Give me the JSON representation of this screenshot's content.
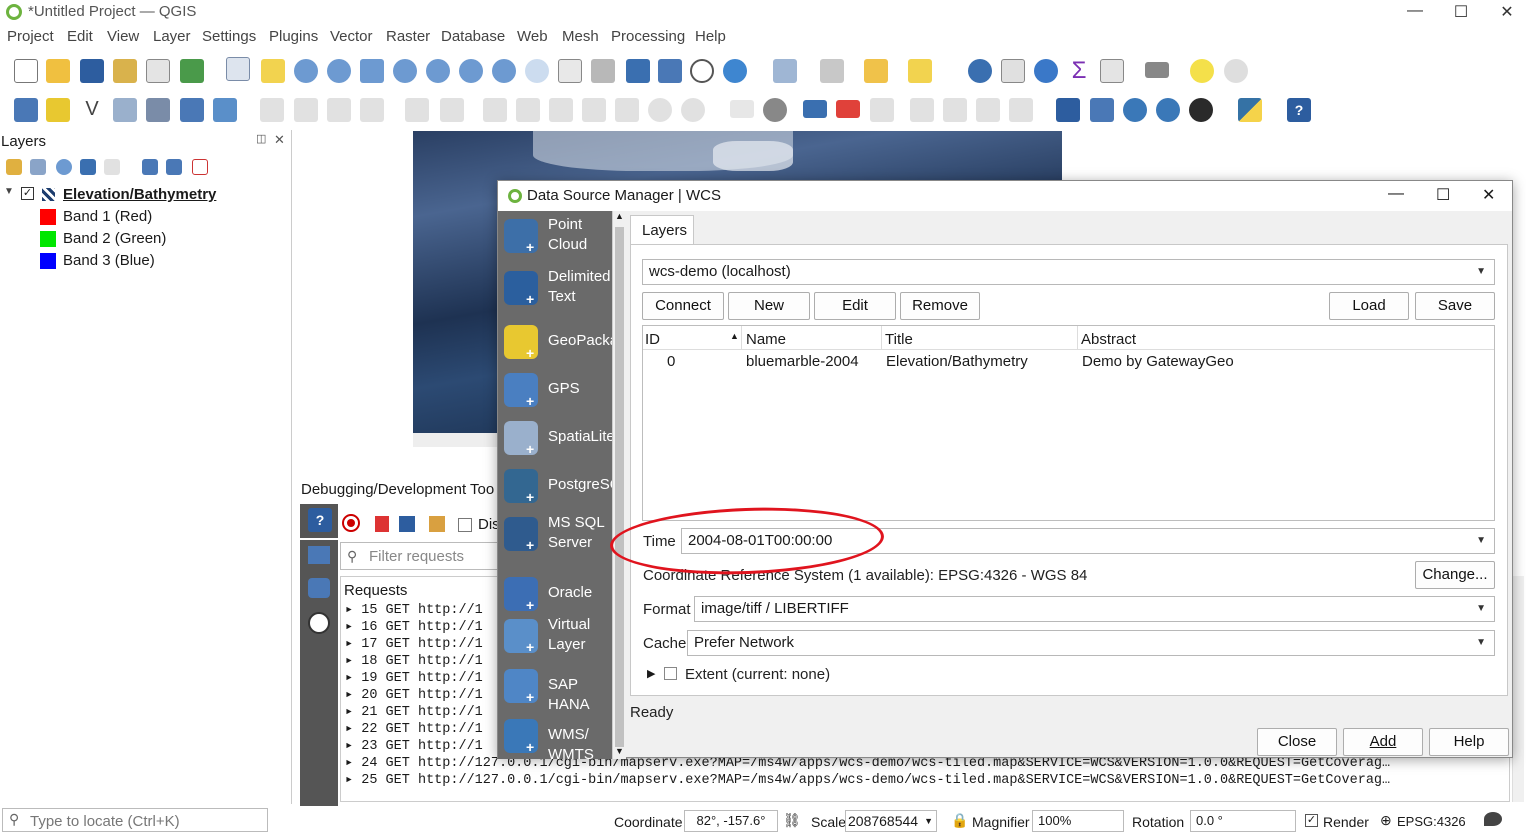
{
  "window": {
    "title": "*Untitled Project — QGIS"
  },
  "menu": [
    "Project",
    "Edit",
    "View",
    "Layer",
    "Settings",
    "Plugins",
    "Vector",
    "Raster",
    "Database",
    "Web",
    "Mesh",
    "Processing",
    "Help"
  ],
  "layers_panel": {
    "title": "Layers",
    "group": "Elevation/Bathymetry",
    "bands": [
      {
        "label": "Band 1 (Red)",
        "color": "#ff0000"
      },
      {
        "label": "Band 2 (Green)",
        "color": "#00e600"
      },
      {
        "label": "Band 3 (Blue)",
        "color": "#0000ff"
      }
    ]
  },
  "debug": {
    "title": "Debugging/Development Too",
    "checkbox_label": "Dis",
    "filter_placeholder": "Filter requests",
    "requests_header": "Requests",
    "requests": [
      {
        "n": "15",
        "m": "GET",
        "u": "http://1"
      },
      {
        "n": "16",
        "m": "GET",
        "u": "http://1"
      },
      {
        "n": "17",
        "m": "GET",
        "u": "http://1"
      },
      {
        "n": "18",
        "m": "GET",
        "u": "http://1"
      },
      {
        "n": "19",
        "m": "GET",
        "u": "http://1"
      },
      {
        "n": "20",
        "m": "GET",
        "u": "http://1"
      },
      {
        "n": "21",
        "m": "GET",
        "u": "http://1"
      },
      {
        "n": "22",
        "m": "GET",
        "u": "http://1"
      },
      {
        "n": "23",
        "m": "GET",
        "u": "http://1"
      },
      {
        "n": "24",
        "m": "GET",
        "u": "http://127.0.0.1/cgi-bin/mapserv.exe?MAP=/ms4w/apps/wcs-demo/wcs-tiled.map&SERVICE=WCS&VERSION=1.0.0&REQUEST=GetCoverag…"
      },
      {
        "n": "25",
        "m": "GET",
        "u": "http://127.0.0.1/cgi-bin/mapserv.exe?MAP=/ms4w/apps/wcs-demo/wcs-tiled.map&SERVICE=WCS&VERSION=1.0.0&REQUEST=GetCoverag…"
      }
    ]
  },
  "dialog": {
    "title": "Data Source Manager | WCS",
    "sidebar": [
      {
        "label": "Point Cloud",
        "icon": "point-cloud-icon",
        "color": "#3d6fa8"
      },
      {
        "label": "Delimited Text",
        "icon": "delimited-text-icon",
        "color": "#2b5f9e"
      },
      {
        "label": "GeoPackage",
        "icon": "geopackage-icon",
        "color": "#e8c830"
      },
      {
        "label": "GPS",
        "icon": "gps-icon",
        "color": "#4a7fc1"
      },
      {
        "label": "SpatiaLite",
        "icon": "spatialite-icon",
        "color": "#9ab0cc"
      },
      {
        "label": "PostgreSQL",
        "icon": "postgresql-icon",
        "color": "#336791"
      },
      {
        "label": "MS SQL Server",
        "icon": "mssql-icon",
        "color": "#2f5b8e"
      },
      {
        "label": "Oracle",
        "icon": "oracle-icon",
        "color": "#3c6eb4"
      },
      {
        "label": "Virtual Layer",
        "icon": "virtual-layer-icon",
        "color": "#5a8fc9"
      },
      {
        "label": "SAP HANA",
        "icon": "sap-hana-icon",
        "color": "#4f86c6"
      },
      {
        "label": "WMS/ WMTS",
        "icon": "wms-icon",
        "color": "#3a78b8"
      }
    ],
    "tab": "Layers",
    "connection": "wcs-demo (localhost)",
    "buttons": {
      "connect": "Connect",
      "new": "New",
      "edit": "Edit",
      "remove": "Remove",
      "load": "Load",
      "save": "Save"
    },
    "table": {
      "headers": [
        "ID",
        "Name",
        "Title",
        "Abstract"
      ],
      "rows": [
        {
          "id": "0",
          "name": "bluemarble-2004",
          "title": "Elevation/Bathymetry",
          "abstract": "Demo by GatewayGeo"
        }
      ]
    },
    "time_label": "Time",
    "time_value": "2004-08-01T00:00:00",
    "crs_text": "Coordinate Reference System (1 available): EPSG:4326 - WGS 84",
    "change_button": "Change...",
    "format_label": "Format",
    "format_value": "image/tiff / LIBERTIFF",
    "cache_label": "Cache",
    "cache_value": "Prefer Network",
    "extent_label": "Extent (current: none)",
    "status": "Ready",
    "close_button": "Close",
    "add_button": "Add",
    "help_button": "Help"
  },
  "statusbar": {
    "locate_placeholder": "Type to locate (Ctrl+K)",
    "coordinate_label": "Coordinate",
    "coordinate_value": "82°, -157.6°",
    "scale_label": "Scale",
    "scale_value": "208768544",
    "magnifier_label": "Magnifier",
    "magnifier_value": "100%",
    "rotation_label": "Rotation",
    "rotation_value": "0.0 °",
    "render_label": "Render",
    "crs": "EPSG:4326"
  }
}
